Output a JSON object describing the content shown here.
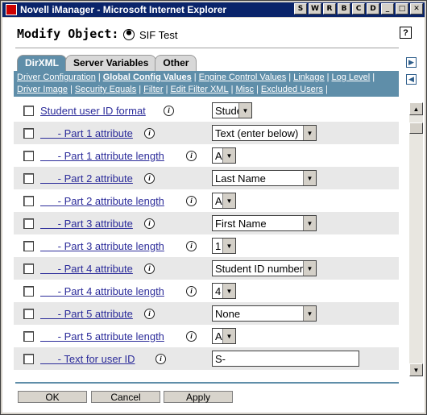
{
  "window": {
    "title": "Novell iManager - Microsoft Internet Explorer",
    "title_buttons": [
      "S",
      "W",
      "R",
      "B",
      "C",
      "D",
      "_",
      "□",
      "✕"
    ]
  },
  "header": {
    "title": "Modify Object:",
    "object_name": "SIF Test",
    "help_label": "?"
  },
  "tabs": [
    {
      "label": "DirXML"
    },
    {
      "label": "Server Variables"
    },
    {
      "label": "Other"
    }
  ],
  "subnav": {
    "line1": [
      "Driver Configuration",
      "Global Config Values",
      "Engine Control Values",
      "Linkage",
      "Log Level"
    ],
    "line2": [
      "Driver Image",
      "Security Equals",
      "Filter",
      "Edit Filter XML",
      "Misc",
      "Excluded Users"
    ],
    "separator": "|"
  },
  "info_glyph": "i",
  "rows": [
    {
      "label": "Student user ID format",
      "type": "select",
      "value": "Student"
    },
    {
      "label": "      - Part 1 attribute",
      "type": "select",
      "value": "Text (enter below)"
    },
    {
      "label": "      - Part 1 attribute length",
      "type": "select",
      "value": "All"
    },
    {
      "label": "      - Part 2 attribute",
      "type": "select",
      "value": "Last Name"
    },
    {
      "label": "      - Part 2 attribute length",
      "type": "select",
      "value": "All"
    },
    {
      "label": "      - Part 3 attribute",
      "type": "select",
      "value": "First Name"
    },
    {
      "label": "      - Part 3 attribute length",
      "type": "select",
      "value": "1"
    },
    {
      "label": "      - Part 4 attribute",
      "type": "select",
      "value": "Student ID number"
    },
    {
      "label": "      - Part 4 attribute length",
      "type": "select",
      "value": "4"
    },
    {
      "label": "      - Part 5 attribute",
      "type": "select",
      "value": "None"
    },
    {
      "label": "      - Part 5 attribute length",
      "type": "select",
      "value": "All"
    },
    {
      "label": "      - Text for user ID",
      "type": "text",
      "value": "S-"
    }
  ],
  "footer": {
    "ok_label": "OK",
    "cancel_label": "Cancel",
    "apply_label": "Apply"
  },
  "colors": {
    "titlebar": "#0a246a",
    "tab_active": "#5f8ea9",
    "link": "#2c2c9a"
  }
}
